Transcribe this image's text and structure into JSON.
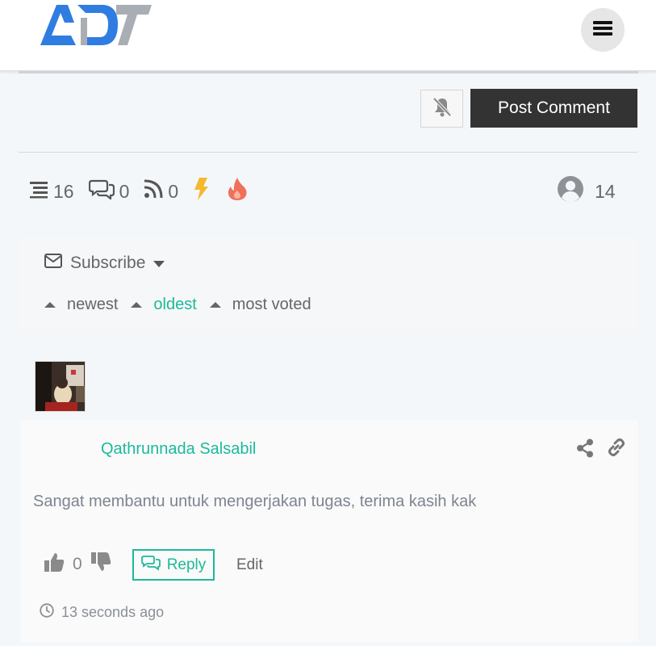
{
  "header": {
    "logo_alt": "ADT",
    "menu_icon": "hamburger-menu-icon"
  },
  "comment_form": {
    "notify_icon": "bell-slash-icon",
    "post_label": "Post Comment"
  },
  "stats": {
    "threads": "16",
    "replies": "0",
    "followers": "0",
    "hot_icon": "bolt-icon",
    "trending_icon": "fire-icon",
    "users": "14"
  },
  "colors": {
    "accent": "#1db99a",
    "bolt": "#f5b82e",
    "fire": "#f0705a",
    "button_dark": "#333333"
  },
  "subscribe": {
    "label": "Subscribe"
  },
  "sort": {
    "items": [
      {
        "label": "newest",
        "active": false
      },
      {
        "label": "oldest",
        "active": true
      },
      {
        "label": "most voted",
        "active": false
      }
    ]
  },
  "comment": {
    "author": "Qathrunnada Salsabil",
    "text": "Sangat membantu untuk mengerjakan tugas, terima kasih kak",
    "votes": "0",
    "reply_label": "Reply",
    "edit_label": "Edit",
    "time": "13 seconds ago"
  }
}
